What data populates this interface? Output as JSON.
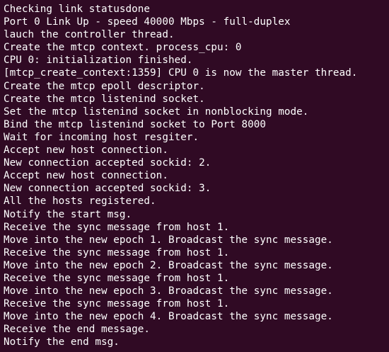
{
  "terminal": {
    "lines": [
      "Checking link statusdone",
      "Port 0 Link Up - speed 40000 Mbps - full-duplex",
      "lauch the controller thread.",
      "Create the mtcp context. process_cpu: 0",
      "CPU 0: initialization finished.",
      "[mtcp_create_context:1359] CPU 0 is now the master thread.",
      "Create the mtcp epoll descriptor.",
      "Create the mtcp listenind socket.",
      "Set the mtcp listenind socket in nonblocking mode.",
      "Bind the mtcp listenind socket to Port 8000",
      "Wait for incoming host resgiter.",
      "Accept new host connection.",
      "New connection accepted sockid: 2.",
      "Accept new host connection.",
      "New connection accepted sockid: 3.",
      "All the hosts registered.",
      "Notify the start msg.",
      "Receive the sync message from host 1.",
      "Move into the new epoch 1. Broadcast the sync message.",
      "Receive the sync message from host 1.",
      "Move into the new epoch 2. Broadcast the sync message.",
      "Receive the sync message from host 1.",
      "Move into the new epoch 3. Broadcast the sync message.",
      "Receive the sync message from host 1.",
      "Move into the new epoch 4. Broadcast the sync message.",
      "Receive the end message.",
      "Notify the end msg."
    ],
    "background_color": "#300a24",
    "text_color": "#ffffff"
  }
}
